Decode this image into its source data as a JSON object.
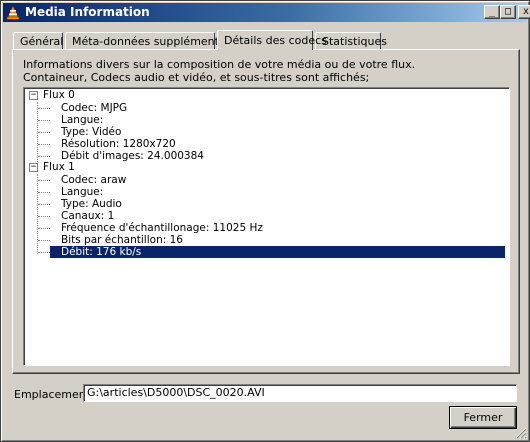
{
  "window": {
    "title": "Media Information",
    "icon": "vlc-cone-icon",
    "controls": {
      "minimize": "_",
      "maximize": "□",
      "close": "x"
    }
  },
  "tabs": [
    {
      "label": "Général",
      "active": false
    },
    {
      "label": "Méta-données supplémentaires",
      "active": false
    },
    {
      "label": "Détails des codecs",
      "active": true
    },
    {
      "label": "Statistiques",
      "active": false
    }
  ],
  "panel": {
    "description_line1": "Informations divers sur la composition de votre média ou de votre flux.",
    "description_line2": "Containeur, Codecs audio et vidéo, et sous-titres sont affichés;"
  },
  "tree": {
    "stream0": {
      "label": "Flux 0",
      "expander": "−",
      "items": [
        "Codec: MJPG",
        "Langue:",
        "Type: Vidéo",
        "Résolution: 1280x720",
        "Débit d'images: 24.000384"
      ]
    },
    "stream1": {
      "label": "Flux 1",
      "expander": "−",
      "items": [
        "Codec: araw",
        "Langue:",
        "Type: Audio",
        "Canaux: 1",
        "Fréquence d'échantillonage: 11025 Hz",
        "Bits par échantillon: 16",
        "Débit: 176 kb/s"
      ],
      "selected_item": "Débit: 176 kb/s"
    }
  },
  "location": {
    "label": "Emplacement :",
    "value": "G:\\articles\\D5000\\DSC_0020.AVI"
  },
  "buttons": {
    "close_label": "Fermer"
  },
  "colors": {
    "titlebar_start": "#0a246a",
    "titlebar_end": "#a6caf0",
    "selection": "#0a246a",
    "face": "#d4d0c8"
  }
}
